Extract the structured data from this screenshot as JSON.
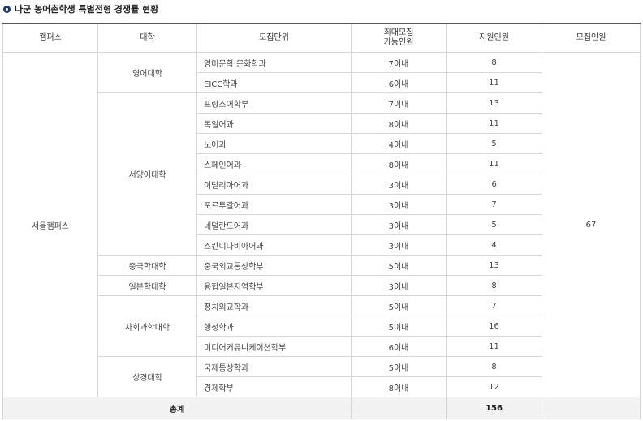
{
  "title": "나군 농어촌학생 특별전형 경쟁률 현황",
  "headers": {
    "campus": "캠퍼스",
    "college": "대학",
    "unit": "모집단위",
    "max_line1": "최대모집",
    "max_line2": "가능인원",
    "applicants": "지원인원",
    "recruit": "모집인원"
  },
  "campus": "서울캠퍼스",
  "recruit_total": "67",
  "colleges": [
    {
      "name": "영어대학",
      "units": [
        {
          "unit": "영미문학·문화학과",
          "max": "7이내",
          "applicants": "8"
        },
        {
          "unit": "EICC학과",
          "max": "6이내",
          "applicants": "11"
        }
      ]
    },
    {
      "name": "서양어대학",
      "units": [
        {
          "unit": "프랑스어학부",
          "max": "7이내",
          "applicants": "13"
        },
        {
          "unit": "독일어과",
          "max": "8이내",
          "applicants": "11"
        },
        {
          "unit": "노어과",
          "max": "4이내",
          "applicants": "5"
        },
        {
          "unit": "스페인어과",
          "max": "8이내",
          "applicants": "11"
        },
        {
          "unit": "이탈리아어과",
          "max": "3이내",
          "applicants": "6"
        },
        {
          "unit": "포르투갈어과",
          "max": "3이내",
          "applicants": "7"
        },
        {
          "unit": "네덜란드어과",
          "max": "3이내",
          "applicants": "5"
        },
        {
          "unit": "스칸디나비아어과",
          "max": "3이내",
          "applicants": "4"
        }
      ]
    },
    {
      "name": "중국학대학",
      "units": [
        {
          "unit": "중국외교통상학부",
          "max": "5이내",
          "applicants": "13"
        }
      ]
    },
    {
      "name": "일본학대학",
      "units": [
        {
          "unit": "융합일본지역학부",
          "max": "3이내",
          "applicants": "8"
        }
      ]
    },
    {
      "name": "사회과학대학",
      "units": [
        {
          "unit": "정치외교학과",
          "max": "5이내",
          "applicants": "7"
        },
        {
          "unit": "행정학과",
          "max": "5이내",
          "applicants": "16"
        },
        {
          "unit": "미디어커뮤니케이션학부",
          "max": "6이내",
          "applicants": "11"
        }
      ]
    },
    {
      "name": "상경대학",
      "units": [
        {
          "unit": "국제통상학과",
          "max": "5이내",
          "applicants": "8"
        },
        {
          "unit": "경제학부",
          "max": "8이내",
          "applicants": "12"
        }
      ]
    }
  ],
  "total": {
    "label": "총계",
    "applicants": "156"
  }
}
